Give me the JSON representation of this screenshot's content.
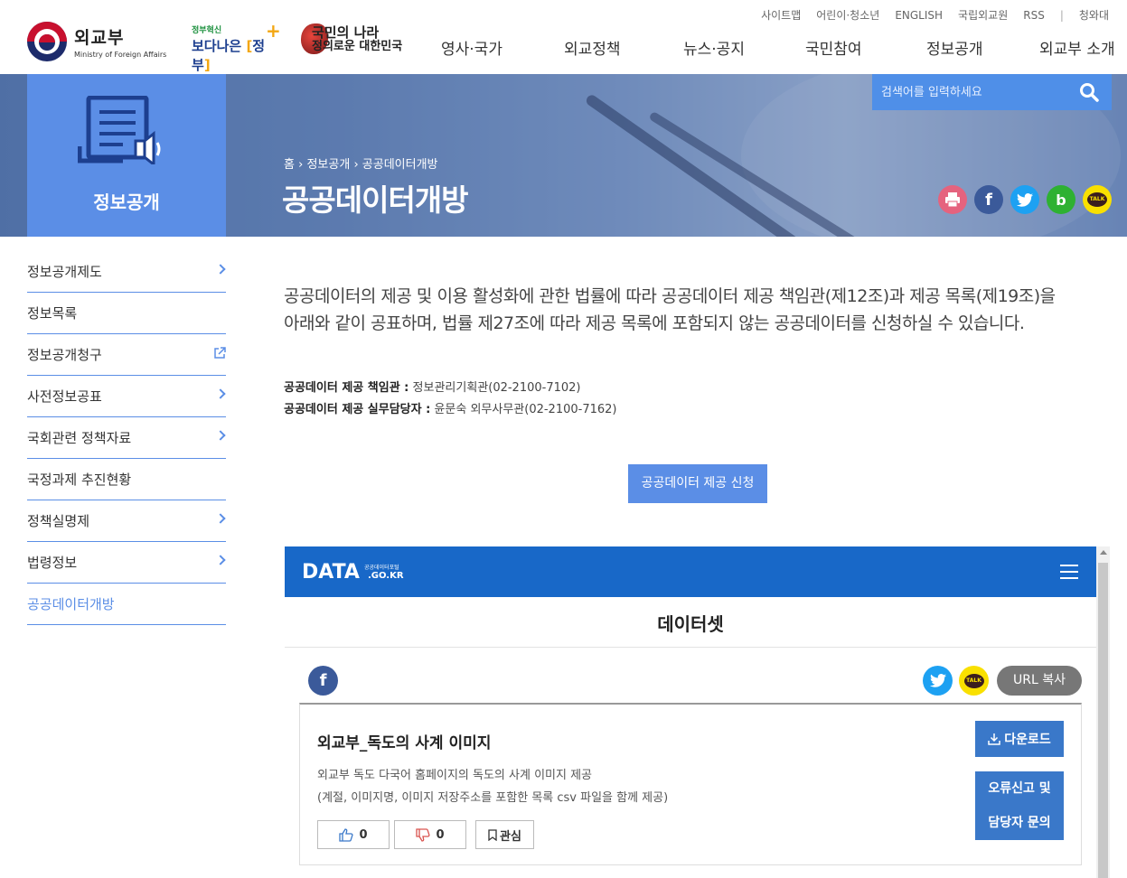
{
  "util_links": [
    "사이트맵",
    "어린이·청소년",
    "ENGLISH",
    "국립외교원",
    "RSS",
    "청와대"
  ],
  "logo": {
    "title": "외교부",
    "subtitle": "Ministry of Foreign Affairs"
  },
  "gov_logo": {
    "small": "정부혁신",
    "big_a": "보다나은",
    "big_b": "정부"
  },
  "nation_logo": {
    "line1": "국민의 나라",
    "line2": "정의로운 대한민국"
  },
  "gnb": [
    "영사·국가",
    "외교정책",
    "뉴스·공지",
    "국민참여",
    "정보공개",
    "외교부 소개"
  ],
  "search": {
    "placeholder": "검색어를 입력하세요"
  },
  "side_title": "정보공개",
  "breadcrumb": {
    "home": "홈",
    "level1": "정보공개",
    "level2": "공공데이터개방",
    "sep": "›"
  },
  "page_title": "공공데이터개방",
  "share_icons": [
    "print-icon",
    "facebook-icon",
    "twitter-icon",
    "band-icon",
    "kakaotalk-icon"
  ],
  "lnb": [
    {
      "label": "정보공개제도",
      "arrow": true
    },
    {
      "label": "정보목록",
      "arrow": false
    },
    {
      "label": "정보공개청구",
      "external": true
    },
    {
      "label": "사전정보공표",
      "arrow": true
    },
    {
      "label": "국회관련 정책자료",
      "arrow": true
    },
    {
      "label": "국정과제 추진현황",
      "arrow": false
    },
    {
      "label": "정책실명제",
      "arrow": true
    },
    {
      "label": "법령정보",
      "arrow": true
    },
    {
      "label": "공공데이터개방",
      "active": true
    }
  ],
  "intro": {
    "line1": "공공데이터의 제공 및 이용 활성화에 관한 법률에 따라 공공데이터 제공 책임관(제12조)과 제공 목록(제19조)을",
    "line2": "아래와 같이 공표하며, 법률 제27조에 따라 제공 목록에 포함되지 않는 공공데이터를 신청하실 수 있습니다."
  },
  "contact": {
    "label1": "공공데이터 제공 책임관 :",
    "value1": "정보관리기획관(02-2100-7102)",
    "label2": "공공데이터 제공 실무담당자 :",
    "value2": "윤문숙 외무사무관(02-2100-7162)"
  },
  "apply_button": "공공데이터 제공 신청",
  "portal": {
    "logo": "DATA",
    "logo_sub": "공공데이터포털",
    "logo_go": ".GO.KR",
    "section_title": "데이터셋",
    "url_copy": "URL 복사",
    "dataset": {
      "title": "외교부_독도의 사계 이미지",
      "desc1": "외교부 독도 다국어 홈페이지의 독도의 사계 이미지 제공",
      "desc2": "(계절, 이미지명, 이미지 저장주소를 포함한 목록 csv 파일을 함께 제공)",
      "likes": "0",
      "dislikes": "0",
      "interest": "관심",
      "download": "다운로드",
      "error_line1": "오류신고 및",
      "error_line2": "담당자 문의"
    }
  },
  "colors": {
    "accent": "#5b8ee6",
    "portal_blue": "#1868c8",
    "button_blue": "#3a78c9"
  }
}
